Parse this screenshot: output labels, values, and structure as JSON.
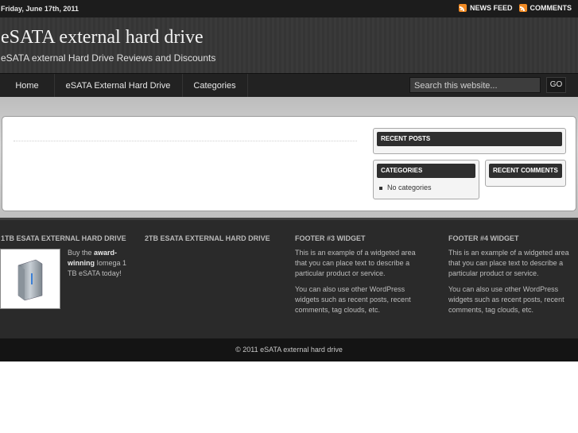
{
  "topbar": {
    "date": "Friday, June 17th, 2011",
    "news_feed": "NEWS FEED",
    "comments": "COMMENTS",
    "rss_icon": "rss-icon",
    "rss_color": "#f08a24"
  },
  "header": {
    "title": "eSATA external hard drive",
    "tagline": "eSATA external Hard Drive Reviews and Discounts"
  },
  "nav": {
    "items": [
      "Home",
      "eSATA External Hard Drive",
      "Categories"
    ],
    "search_placeholder": "Search this website...",
    "search_button": "GO"
  },
  "sidebar": {
    "recent_posts": "RECENT POSTS",
    "categories": "CATEGORIES",
    "no_categories": "No categories",
    "recent_comments": "RECENT COMMENTS"
  },
  "footer": {
    "w1_title": "1TB ESATA EXTERNAL HARD DRIVE",
    "w1_text_pre": "Buy the",
    "w1_text_bold": "award-winning",
    "w1_text_post": "Iomega 1 TB eSATA today!",
    "w2_title": "2TB ESATA EXTERNAL HARD DRIVE",
    "w3_title": "FOOTER #3 WIDGET",
    "w3_p1": "This is an example of a widgeted area that you can place text to describe a particular product or service.",
    "w3_p2": "You can also use other WordPress widgets such as recent posts, recent comments, tag clouds, etc.",
    "w4_title": "FOOTER #4 WIDGET",
    "w4_p1": "This is an example of a widgeted area that you can place text to describe a particular product or service.",
    "w4_p2": "You can also use other WordPress widgets such as recent posts, recent comments, tag clouds, etc."
  },
  "copyright": "© 2011 eSATA external hard drive"
}
